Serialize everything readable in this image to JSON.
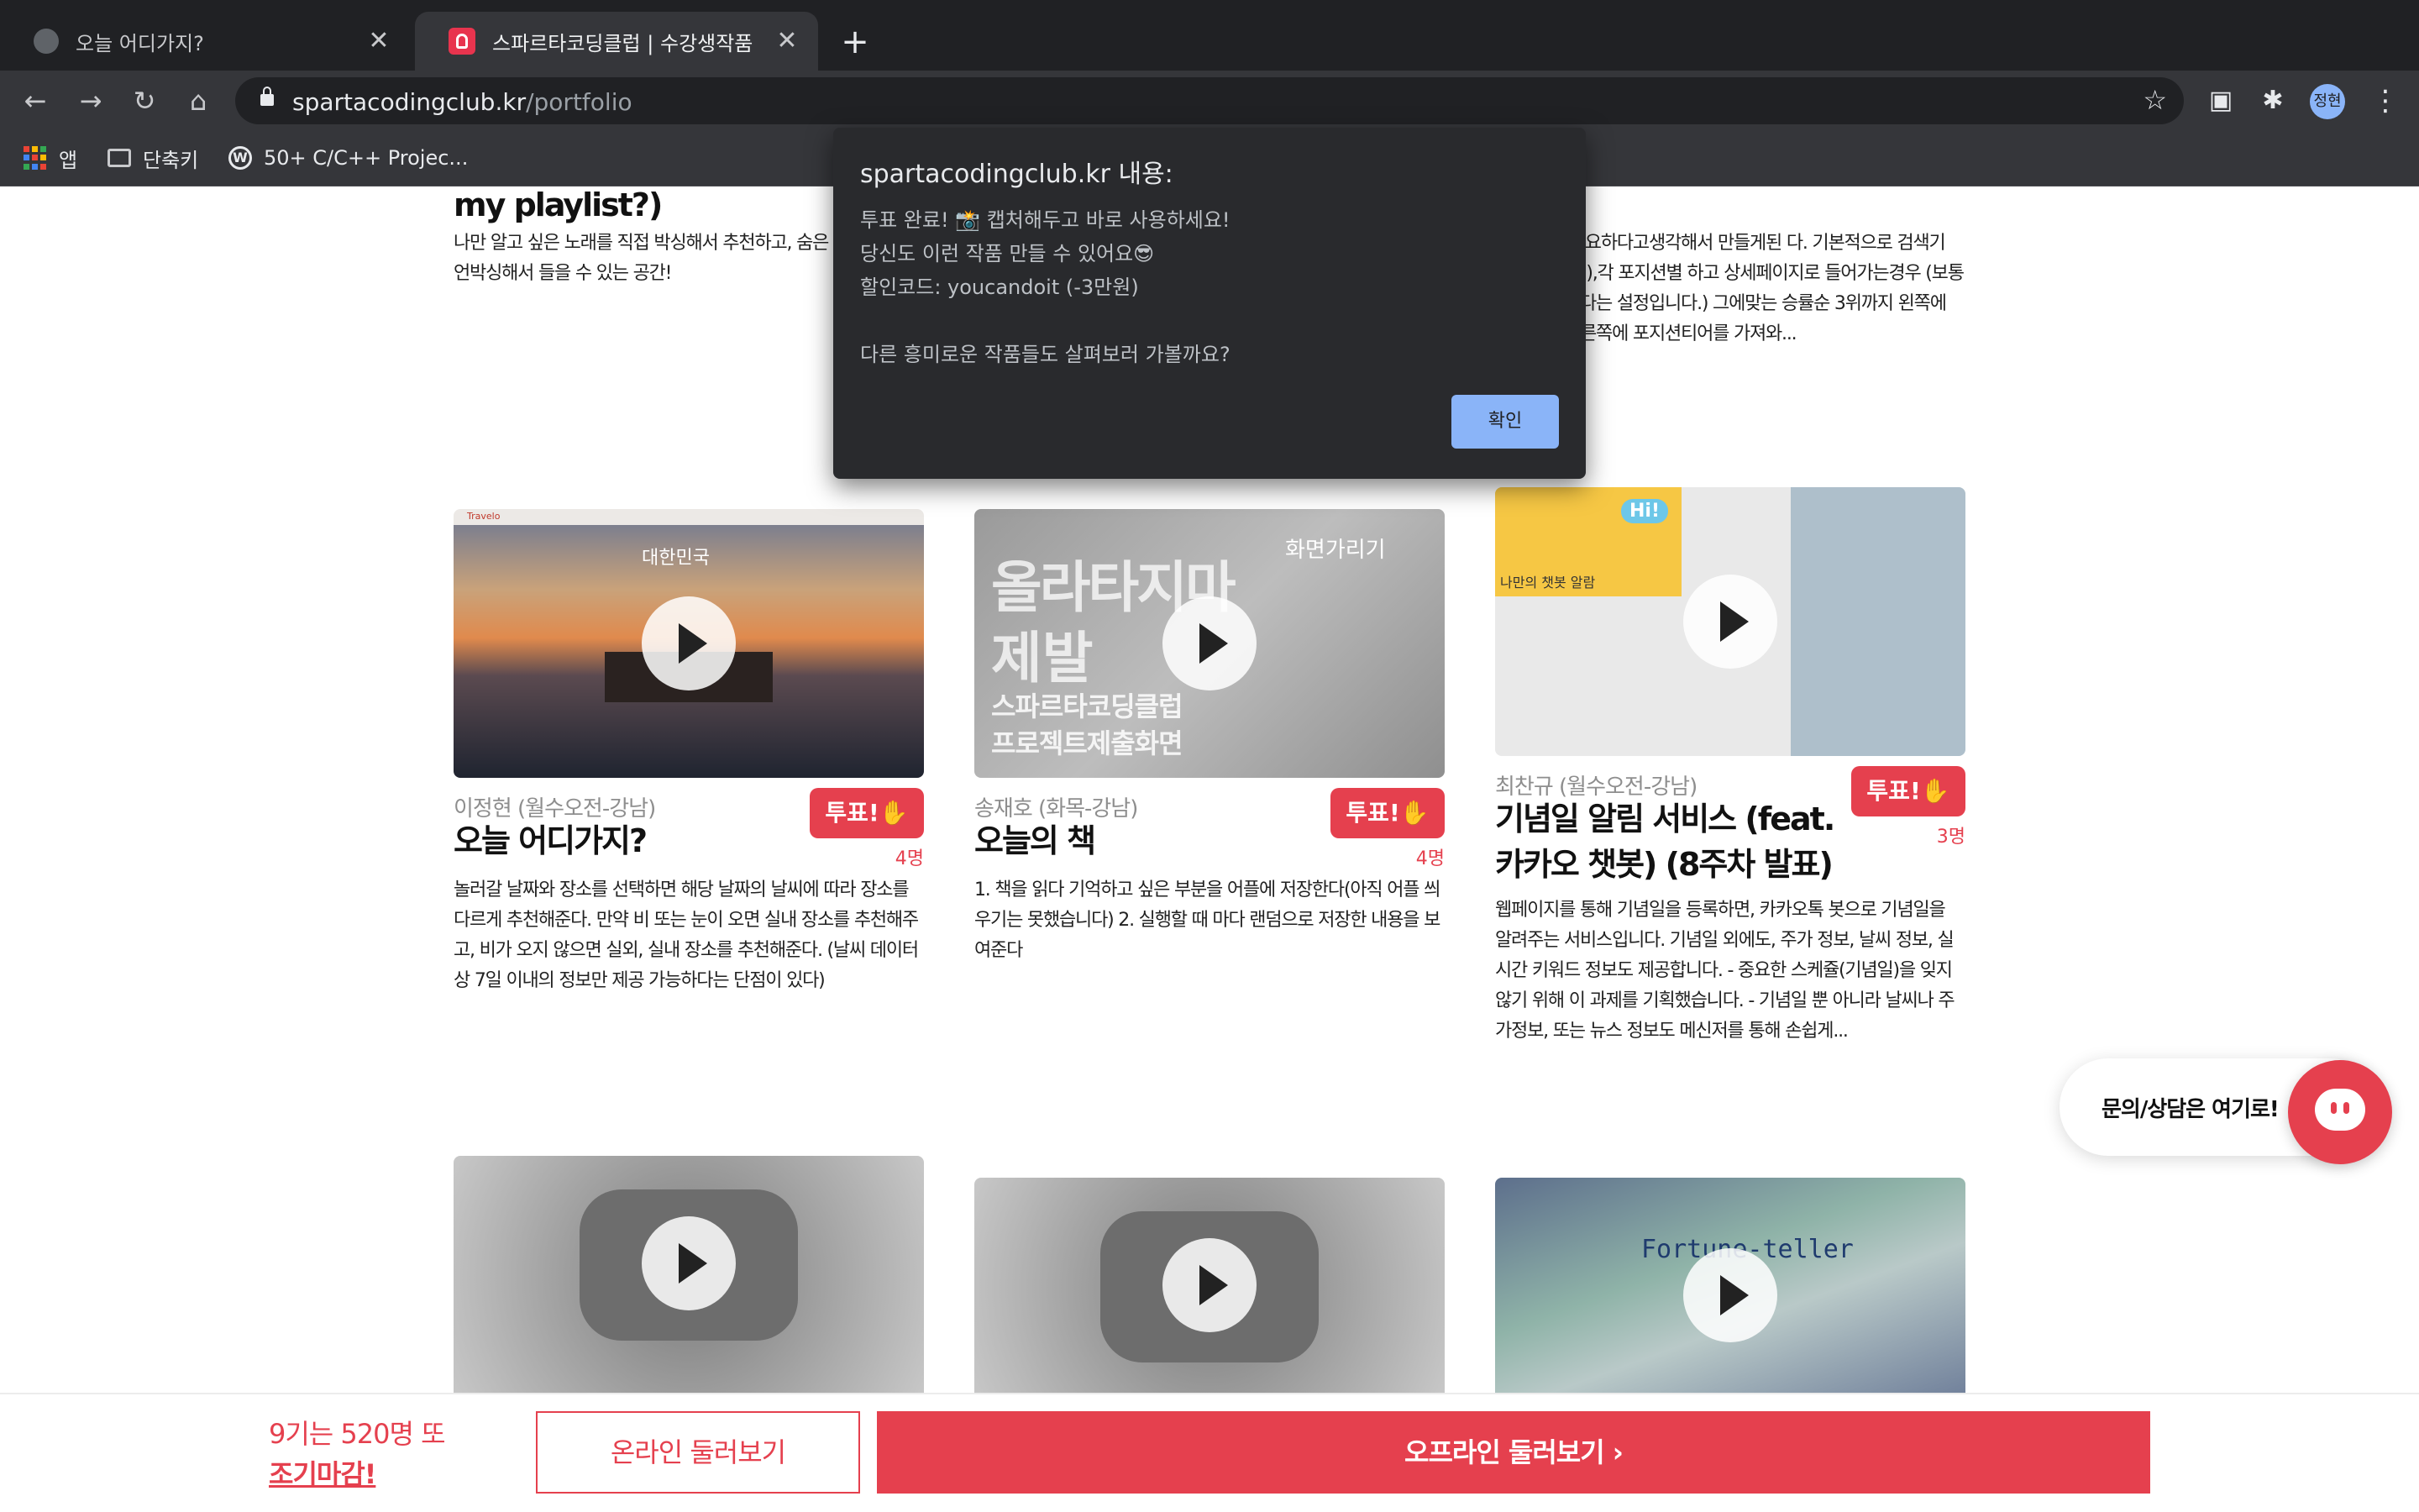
{
  "browser": {
    "tabs": [
      {
        "title": "오늘 어디가지?",
        "active": false
      },
      {
        "title": "스파르타코딩클럽 | 수강생작품",
        "active": true
      }
    ],
    "address": {
      "domain": "spartacodingclub.kr",
      "path": "/portfolio"
    },
    "profile_initials": "정현",
    "bookmarks": [
      "앱",
      "단축키",
      "50+ C/C++ Projec..."
    ]
  },
  "dialog": {
    "title": "spartacodingclub.kr 내용:",
    "line1": "투표 완료! 📸 캡처해두고 바로 사용하세요!",
    "line2": "당신도 이런 작품 만들 수 있어요😎",
    "line3": "할인코드: youcandoit (-3만원)",
    "line4": "다른 흥미로운 작품들도 살펴보러 가볼까요?",
    "ok_label": "확인"
  },
  "top_partial": {
    "left_title": "my playlist?)",
    "left_desc": "나만 알고 싶은 노래를 직접 박싱해서 추천하고, 숨은 언박싱해서 들을 수 있는 공간!",
    "right_desc": "는 저에게 필요하다고생각해서 만들게된 다. 기본적으로 검색기능,(초성검색),각 포지션별 하고 상세페이지로 들어가는경우 (보통 상대방 어간다는 설정입니다.) 그에맞는 승률순 3위까지 왼쪽에 보여주며 오른쪽에 포지션티어를 가져와..."
  },
  "projects": [
    {
      "author": "이정현 (월수오전-강남)",
      "vote_label": "투표!✋",
      "votes": "4명",
      "title": "오늘 어디가지?",
      "desc": "놀러갈 날짜와 장소를 선택하면 해당 날짜의 날씨에 따라 장소를 다르게 추천해준다. 만약 비 또는 눈이 오면 실내 장소를 추천해주고, 비가 오지 않으면 실외, 실내 장소를 추천해준다. (날씨 데이터 상 7일 이내의 정보만 제공 가능하다는 단점이 있다)",
      "thumb": {
        "brand": "Travelo",
        "heading": "대한민국"
      }
    },
    {
      "author": "송재호 (화목-강남)",
      "vote_label": "투표!✋",
      "votes": "4명",
      "title": "오늘의 책",
      "desc": "1. 책을 읽다 기억하고 싶은 부분을 어플에 저장한다(아직 어플 씌우기는 못했습니다) 2. 실행할 때 마다 랜덤으로 저장한 내용을 보여준다",
      "thumb": {
        "line1": "올라타지마",
        "line2": "제발",
        "line3": "스파르타코딩클럽",
        "line4": "프로젝트제출화면",
        "corner": "화면가리기"
      }
    },
    {
      "author": "최찬규 (월수오전-강남)",
      "vote_label": "투표!✋",
      "votes": "3명",
      "title": "기념일 알림 서비스 (feat. 카카오 챗봇) (8주차 발표)",
      "desc": "웹페이지를 통해 기념일을 등록하면, 카카오톡 봇으로 기념일을 알려주는 서비스입니다. 기념일 외에도, 주가 정보, 날씨 정보, 실시간 키워드 정보도 제공합니다. - 중요한 스케쥴(기념일)을 잊지 않기 위해 이 과제를 기획했습니다. - 기념일 뿐 아니라 날씨나 주가정보, 또는 뉴스 정보도 메신저를 통해 손쉽게...",
      "thumb": {
        "bubble": "Hi!",
        "caption": "나만의 챗봇 알람"
      }
    }
  ],
  "bottom_row": {
    "third_thumb_title": "Fortune-teller"
  },
  "chat": {
    "label": "문의/상담은 여기로!"
  },
  "bottom_bar": {
    "promo_line1": "9기는 520명 또",
    "promo_line2": "조기마감!",
    "online_label": "온라인 둘러보기",
    "offline_label": "오프라인 둘러보기 ›"
  },
  "colors": {
    "accent": "#e5404e",
    "dialog_bg": "#292a2d",
    "chrome_bg": "#202124",
    "ok_button": "#8ab4f8"
  }
}
